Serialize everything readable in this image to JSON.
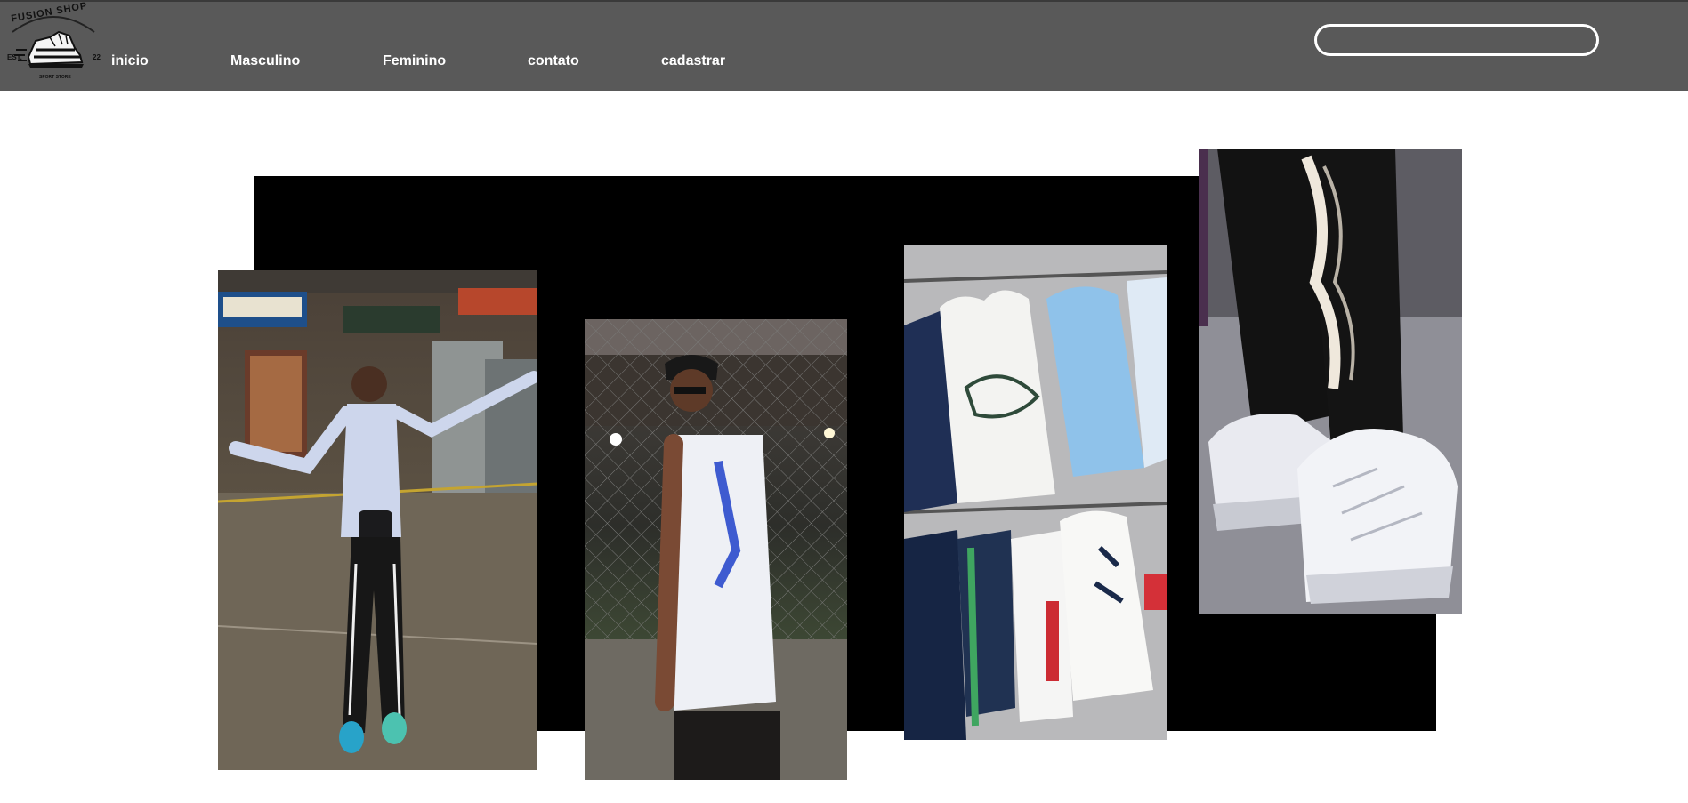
{
  "brand": {
    "logo_top": "FUSION SHOP",
    "logo_est": "EST.",
    "logo_num": "22",
    "logo_sub": "SPORT STORE"
  },
  "nav": {
    "items": [
      {
        "label": "inicio"
      },
      {
        "label": "Masculino"
      },
      {
        "label": "Feminino"
      },
      {
        "label": "contato"
      },
      {
        "label": "cadastrar"
      }
    ]
  },
  "search": {
    "value": "",
    "placeholder": ""
  },
  "colors": {
    "header_bg": "#595959",
    "nav_text": "#ffffff",
    "backdrop": "#000000",
    "page_bg": "#ffffff"
  },
  "gallery": {
    "photos": [
      {
        "subject": "man-posing-at-gas-station"
      },
      {
        "subject": "man-in-football-jersey-at-night"
      },
      {
        "subject": "clothing-rack-in-store"
      },
      {
        "subject": "white-sneakers-close-up"
      }
    ]
  }
}
